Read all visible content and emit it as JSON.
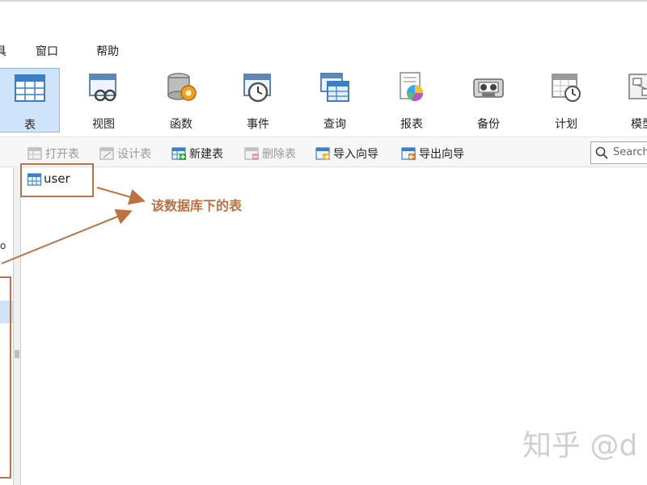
{
  "menubar": {
    "items": [
      {
        "label": "具"
      },
      {
        "label": "窗口"
      },
      {
        "label": "帮助"
      }
    ]
  },
  "toolbar": {
    "tools": [
      {
        "label": "表",
        "icon": "table-icon",
        "active": true
      },
      {
        "label": "视图",
        "icon": "view-icon"
      },
      {
        "label": "函数",
        "icon": "function-icon"
      },
      {
        "label": "事件",
        "icon": "event-icon"
      },
      {
        "label": "查询",
        "icon": "query-icon"
      },
      {
        "label": "报表",
        "icon": "report-icon"
      },
      {
        "label": "备份",
        "icon": "backup-icon"
      },
      {
        "label": "计划",
        "icon": "schedule-icon"
      },
      {
        "label": "模型",
        "icon": "model-icon"
      }
    ]
  },
  "actionbar": {
    "actions": [
      {
        "label": "打开表",
        "icon": "open-table-icon",
        "enabled": false
      },
      {
        "label": "设计表",
        "icon": "design-table-icon",
        "enabled": false
      },
      {
        "label": "新建表",
        "icon": "new-table-icon",
        "enabled": true
      },
      {
        "label": "删除表",
        "icon": "delete-table-icon",
        "enabled": false
      },
      {
        "label": "导入向导",
        "icon": "import-wizard-icon",
        "enabled": true
      },
      {
        "label": "导出向导",
        "icon": "export-wizard-icon",
        "enabled": true
      }
    ],
    "search": {
      "placeholder": "Search",
      "icon": "search-icon"
    }
  },
  "sidebar": {
    "marker": "o"
  },
  "objects": {
    "tables": [
      {
        "name": "user",
        "icon": "table-icon"
      }
    ]
  },
  "annotation": {
    "text": "该数据库下的表",
    "color": "#c0703f"
  },
  "watermark": {
    "text": "知乎 @d"
  },
  "colors": {
    "active_tool_bg": "#cfe4fb",
    "annotation_box": "#b8744a"
  }
}
